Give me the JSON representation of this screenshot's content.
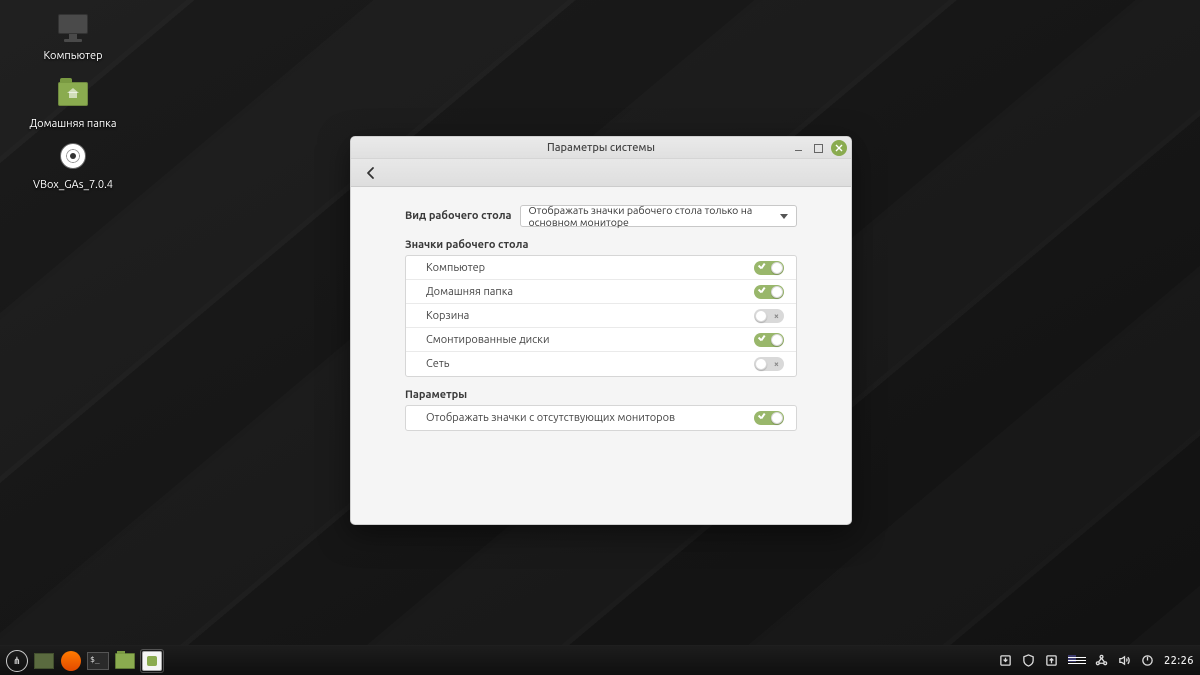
{
  "desktop_icons": [
    {
      "id": "computer",
      "label": "Компьютер"
    },
    {
      "id": "home",
      "label": "Домашняя папка"
    },
    {
      "id": "vbox",
      "label": "VBox_GAs_7.0.4"
    }
  ],
  "window": {
    "title": "Параметры системы",
    "desktop_view_label": "Вид рабочего стола",
    "desktop_view_value": "Отображать значки рабочего стола только на основном мониторе",
    "section_icons": "Значки рабочего стола",
    "icons": [
      {
        "label": "Компьютер",
        "on": true
      },
      {
        "label": "Домашняя папка",
        "on": true
      },
      {
        "label": "Корзина",
        "on": false
      },
      {
        "label": "Смонтированные диски",
        "on": true
      },
      {
        "label": "Сеть",
        "on": false
      }
    ],
    "section_params": "Параметры",
    "params": [
      {
        "label": "Отображать значки с отсутствующих мониторов",
        "on": true
      }
    ]
  },
  "taskbar": {
    "clock": "22:26",
    "kb_layout": "US"
  }
}
